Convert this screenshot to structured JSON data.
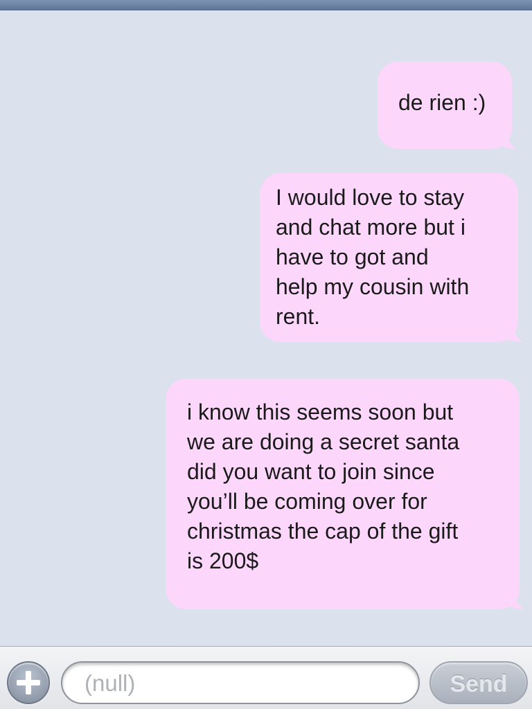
{
  "thread": {
    "messages": [
      {
        "sender": "me",
        "text": "de rien :)"
      },
      {
        "sender": "me",
        "lines": [
          "I would love to stay",
          "and chat more but i",
          "have to got and",
          "help my cousin with",
          "rent."
        ]
      },
      {
        "sender": "me",
        "lines": [
          "i know this seems soon but",
          "we are doing a secret santa",
          "did you want to join since",
          "you’ll be coming over for",
          "christmas the cap of the gift",
          "is 200$"
        ]
      }
    ]
  },
  "composer": {
    "add_icon": "plus-icon",
    "placeholder": "(null)",
    "send_label": "Send"
  },
  "colors": {
    "background": "#dbe2ed",
    "bubble": "#fdd7fb"
  }
}
